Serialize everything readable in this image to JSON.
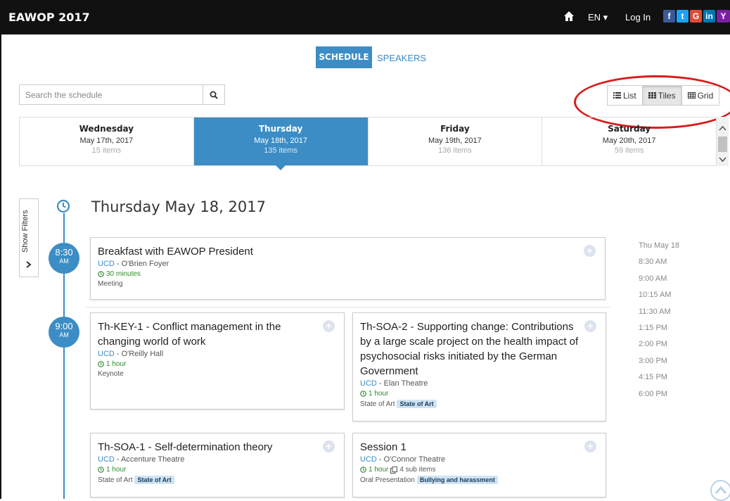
{
  "topbar": {
    "brand": "EAWOP 2017",
    "lang": "EN ▾",
    "login": "Log In",
    "social": {
      "facebook": "f",
      "twitter": "t",
      "google": "G",
      "linkedin": "in",
      "youtube": "Y"
    }
  },
  "tabs": {
    "schedule": "SCHEDULE",
    "speakers": "SPEAKERS"
  },
  "search": {
    "placeholder": "Search the schedule"
  },
  "views": {
    "list": "List",
    "tiles": "Tiles",
    "grid": "Grid",
    "active": "Tiles"
  },
  "days": [
    {
      "name": "Wednesday",
      "date": "May 17th, 2017",
      "items": "15 items"
    },
    {
      "name": "Thursday",
      "date": "May 18th, 2017",
      "items": "135 items"
    },
    {
      "name": "Friday",
      "date": "May 19th, 2017",
      "items": "136 items"
    },
    {
      "name": "Saturday",
      "date": "May 20th, 2017",
      "items": "59 items"
    }
  ],
  "filters": {
    "label": "Show Filters"
  },
  "heading": "Thursday May 18, 2017",
  "slots": [
    {
      "time": "8:30",
      "ampm": "AM"
    },
    {
      "time": "9:00",
      "ampm": "AM"
    }
  ],
  "cards": [
    {
      "title": "Breakfast with EAWOP President",
      "venue": "UCD",
      "room": " - O'Brien Foyer",
      "duration": "30 minutes",
      "type": "Meeting",
      "badge": ""
    },
    {
      "title": "Th-KEY-1 - Conflict management in the changing world of work",
      "venue": "UCD",
      "room": " - O'Reilly Hall",
      "duration": "1 hour",
      "type": "Keynote",
      "badge": ""
    },
    {
      "title": "Th-SOA-2 - Supporting change: Contributions by a large scale project on the health impact of psychosocial risks initiated by the German Government",
      "venue": "UCD",
      "room": " - Elan Theatre",
      "duration": "1 hour",
      "type": "State of Art",
      "badge": "State of Art"
    },
    {
      "title": "Th-SOA-1 - Self-determination theory",
      "venue": "UCD",
      "room": " - Accenture Theatre",
      "duration": "1 hour",
      "type": "State of Art",
      "badge": "State of Art"
    },
    {
      "title": "Session 1",
      "venue": "UCD",
      "room": " - O'Connor Theatre",
      "duration": "1 hour",
      "subitems": "4 sub items",
      "type": "Oral Presentation",
      "badge": "Bullying and harassment"
    }
  ],
  "times": [
    "Thu May 18",
    "8:30 AM",
    "9:00 AM",
    "10:15 AM",
    "11:30 AM",
    "1:15 PM",
    "2:00 PM",
    "3:00 PM",
    "4:15 PM",
    "6:00 PM"
  ],
  "colors": {
    "accent": "#3c8dc5",
    "topbar": "#111111",
    "annotation": "#d91c1c",
    "duration": "#2e8b2e"
  }
}
